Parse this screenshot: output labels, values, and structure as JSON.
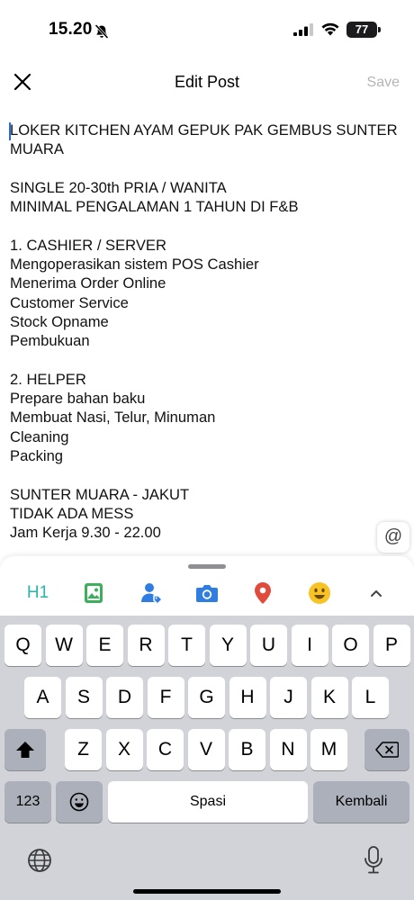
{
  "status_bar": {
    "time": "15.20",
    "battery": "77"
  },
  "header": {
    "title": "Edit Post",
    "save_label": "Save"
  },
  "post": {
    "lines": [
      "LOKER KITCHEN AYAM GEPUK PAK GEMBUS SUNTER",
      "MUARA",
      "",
      "SINGLE 20-30th PRIA / WANITA",
      "MINIMAL PENGALAMAN 1 TAHUN DI F&B",
      "",
      "1. CASHIER / SERVER",
      "Mengoperasikan sistem POS Cashier",
      "Menerima Order Online",
      "Customer Service",
      "Stock Opname",
      "Pembukuan",
      "",
      "2. HELPER",
      "Prepare bahan baku",
      "Membuat Nasi, Telur, Minuman",
      "Cleaning",
      "Packing",
      "",
      "SUNTER MUARA - JAKUT",
      "TIDAK ADA MESS",
      "Jam Kerja 9.30 - 22.00"
    ]
  },
  "mention_button": {
    "symbol": "@"
  },
  "toolbar": {
    "h1_label": "H1",
    "icons": [
      "image-icon",
      "tag-person-icon",
      "camera-icon",
      "location-pin-icon",
      "emoji-icon",
      "chevron-up-icon"
    ],
    "colors": {
      "h1": "#2bb5a6",
      "image": "#3cae5c",
      "person": "#2f7de1",
      "camera": "#2f7de1",
      "location": "#e24a3b",
      "emoji": "#f7c325"
    }
  },
  "keyboard": {
    "row1": [
      "Q",
      "W",
      "E",
      "R",
      "T",
      "Y",
      "U",
      "I",
      "O",
      "P"
    ],
    "row2": [
      "A",
      "S",
      "D",
      "F",
      "G",
      "H",
      "J",
      "K",
      "L"
    ],
    "row3": [
      "Z",
      "X",
      "C",
      "V",
      "B",
      "N",
      "M"
    ],
    "numbers_label": "123",
    "space_label": "Spasi",
    "return_label": "Kembali"
  }
}
